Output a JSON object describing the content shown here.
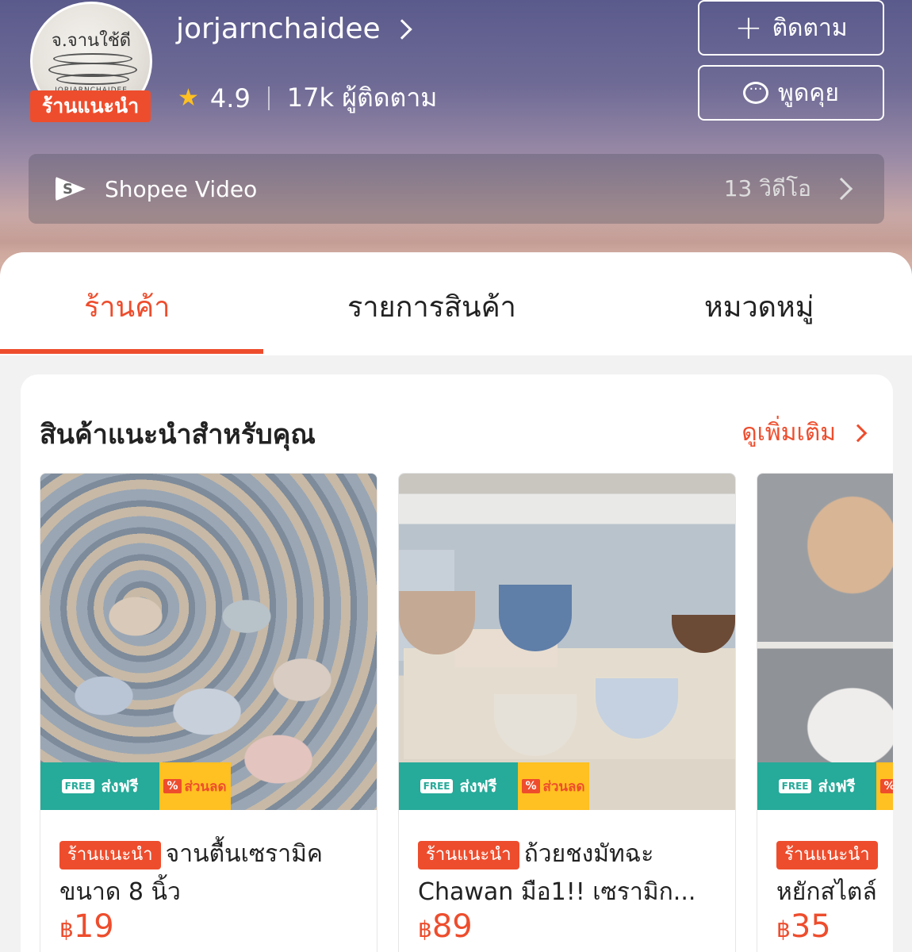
{
  "shop": {
    "name": "jorjarnchaidee",
    "avatar_text": "จ.จานใช้ดี",
    "avatar_sub": "JORJARNCHAIDEE",
    "badge": "ร้านแนะนำ",
    "rating": "4.9",
    "followers": "17k ผู้ติดตาม"
  },
  "actions": {
    "follow_label": "ติดตาม",
    "chat_label": "พูดคุย"
  },
  "video": {
    "label": "Shopee Video",
    "count": "13 วิดีโอ"
  },
  "tabs": [
    {
      "label": "ร้านค้า",
      "active": true
    },
    {
      "label": "รายการสินค้า",
      "active": false
    },
    {
      "label": "หมวดหมู่",
      "active": false
    }
  ],
  "recommend": {
    "title": "สินค้าแนะนำสำหรับคุณ",
    "see_more": "ดูเพิ่มเติม"
  },
  "promo": {
    "free_text": "ส่งฟรี",
    "free_small": "FREE",
    "discount_text": "ส่วนลด"
  },
  "products": [
    {
      "tag": "ร้านแนะนำ",
      "title": "จานตื้นเซรามิค ขนาด 8 นิ้ว",
      "currency": "฿",
      "price": "19"
    },
    {
      "tag": "ร้านแนะนำ",
      "title": "ถ้วยชงมัทฉะ Chawan มือ1!! เซรามิก...",
      "currency": "฿",
      "price": "89"
    },
    {
      "tag": "ร้านแนะนำ",
      "title": "หยักสไตล์",
      "currency": "฿",
      "price": "35"
    }
  ],
  "colors": {
    "accent": "#ee4d2d",
    "free_green": "#26aa99",
    "discount_yellow": "#ffc021",
    "star": "#ffc021"
  }
}
